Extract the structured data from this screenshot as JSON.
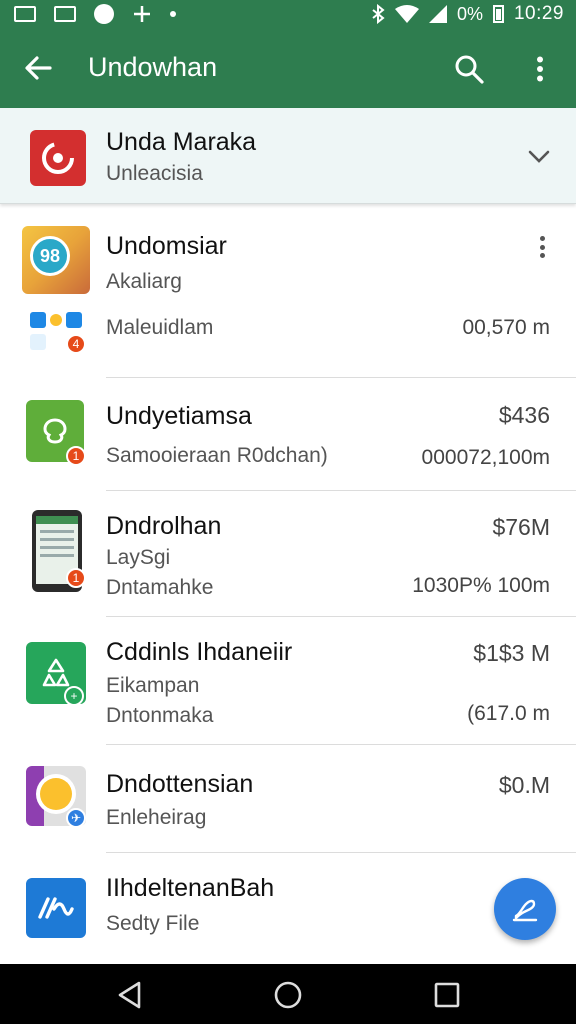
{
  "status_bar": {
    "time": "10:29",
    "battery_text": "0%",
    "icons": [
      "notification-icon",
      "gallery-icon",
      "chrome-icon",
      "sync-icon",
      "dot-icon",
      "bluetooth-icon",
      "wifi-icon",
      "signal-icon",
      "battery-icon"
    ]
  },
  "app_bar": {
    "title": "Undowhan",
    "back_icon": "arrow-back-icon",
    "search_icon": "search-icon",
    "menu_icon": "more-vert-icon",
    "color": "#2e7d4f"
  },
  "header": {
    "title": "Unda Maraka",
    "subtitle": "Unleacisia",
    "icon": "app-logo-icon",
    "icon_color": "#d32f2f",
    "chevron": "chevron-down-icon"
  },
  "items": [
    {
      "title": "Undomsiar",
      "subtitle": "Akaliarg",
      "extra": "Maleuidlam",
      "right": "00,570 m"
    },
    {
      "title": "Undyetiamsa",
      "subtitle": "Samooieraan R0dchan)",
      "right_top": "$436",
      "right": "000072,100m"
    },
    {
      "title": "Dndrolhan",
      "subtitle": "LaySgi",
      "extra": "Dntamahke",
      "right_top": "$76M",
      "right": "1030P% 100m"
    },
    {
      "title": "Cddinls Ihdaneiir",
      "subtitle": "Eikampan",
      "extra": "Dntonmaka",
      "right_top": "$1$3 M",
      "right": "(617.0 m"
    },
    {
      "title": "Dndottensian",
      "subtitle": "Enleheirag",
      "right_top": "$0.M"
    },
    {
      "title": "IIhdeltenanBah",
      "subtitle": "Sedty File"
    }
  ],
  "fab": {
    "icon": "edit-sign-icon",
    "color": "#2f7fe0"
  },
  "nav": {
    "back": "nav-back-icon",
    "home": "nav-home-icon",
    "recents": "nav-recents-icon"
  }
}
